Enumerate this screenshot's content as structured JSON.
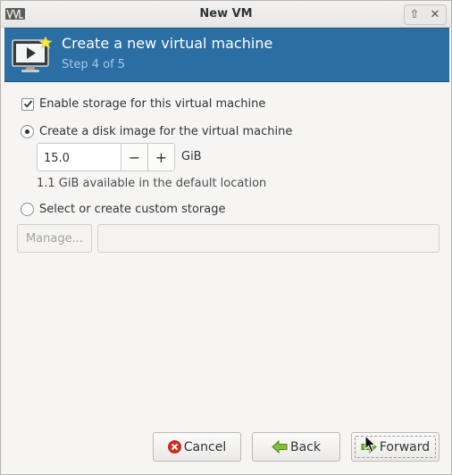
{
  "window": {
    "title": "New VM",
    "titlebar_buttons": [
      {
        "name": "maximize",
        "glyph": "⇧"
      },
      {
        "name": "close",
        "glyph": "✕"
      }
    ]
  },
  "banner": {
    "title": "Create a new virtual machine",
    "step": "Step 4 of 5",
    "icon": "monitor-play-icon",
    "color": "#2a6ea3"
  },
  "storage": {
    "enable_label": "Enable storage for this virtual machine",
    "enable_checked": true,
    "option_disk_label": "Create a disk image for the virtual machine",
    "option_disk_selected": true,
    "size_value": "15.0",
    "decrement_label": "−",
    "increment_label": "+",
    "unit": "GiB",
    "available_text": "1.1 GiB available in the default location",
    "option_custom_label": "Select or create custom storage",
    "option_custom_selected": false,
    "manage_label": "Manage...",
    "custom_path_value": ""
  },
  "footer": {
    "cancel_label": "Cancel",
    "back_label": "Back",
    "forward_label": "Forward"
  }
}
